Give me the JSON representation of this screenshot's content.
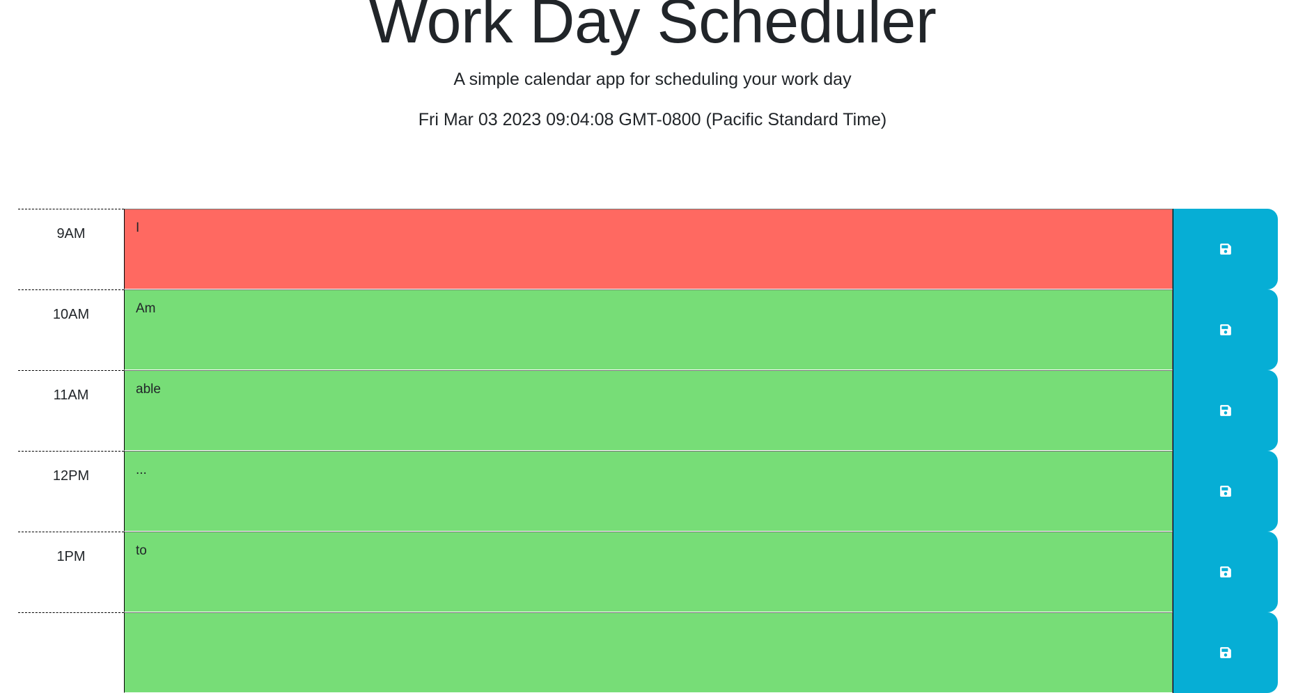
{
  "header": {
    "title": "Work Day Scheduler",
    "lead": "A simple calendar app for scheduling your work day",
    "current_day": "Fri Mar 03 2023 09:04:08 GMT-0800 (Pacific Standard Time)"
  },
  "colors": {
    "present": "#ff6961",
    "future": "#77dd77",
    "save_button": "#06aed5"
  },
  "time_blocks": [
    {
      "hour": "9AM",
      "text": "I",
      "status": "present",
      "save_icon": "save-icon"
    },
    {
      "hour": "10AM",
      "text": "Am",
      "status": "future",
      "save_icon": "save-icon"
    },
    {
      "hour": "11AM",
      "text": "able",
      "status": "future",
      "save_icon": "save-icon"
    },
    {
      "hour": "12PM",
      "text": "...",
      "status": "future",
      "save_icon": "save-icon"
    },
    {
      "hour": "1PM",
      "text": "to",
      "status": "future",
      "save_icon": "save-icon"
    },
    {
      "hour": "",
      "text": "",
      "status": "future",
      "save_icon": "save-icon"
    }
  ]
}
